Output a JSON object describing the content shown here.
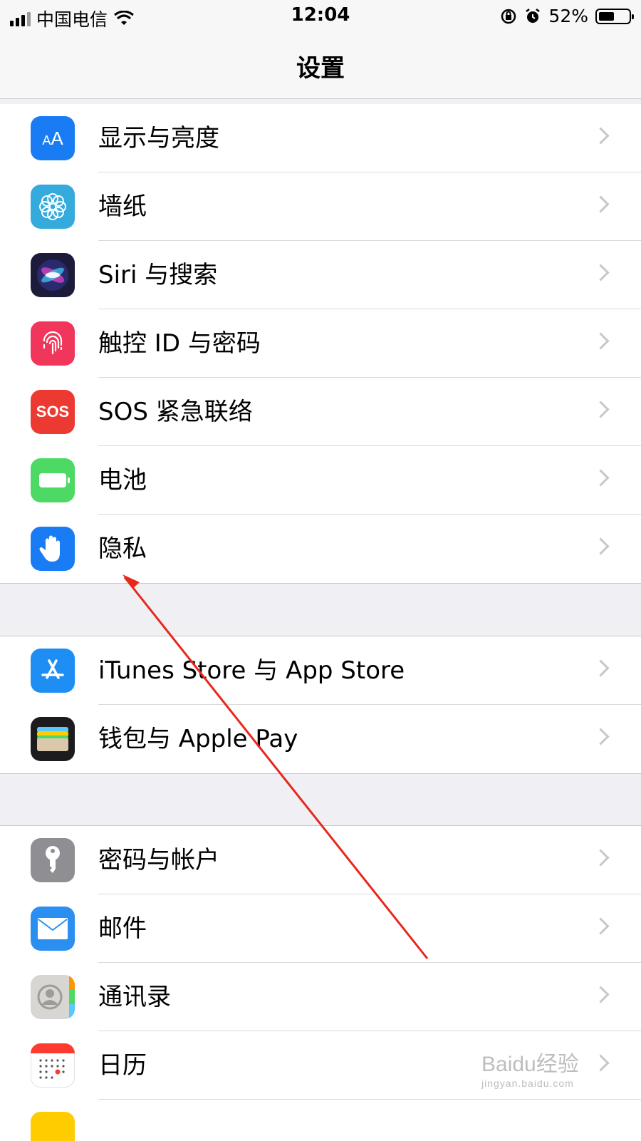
{
  "status_bar": {
    "carrier": "中国电信",
    "time": "12:04",
    "battery_text": "52%",
    "battery_level": 0.52
  },
  "nav": {
    "title": "设置"
  },
  "sections": [
    {
      "items": [
        {
          "label": "显示与亮度",
          "icon": "display-brightness-icon",
          "color": "#1a7cf5"
        },
        {
          "label": "墙纸",
          "icon": "wallpaper-flower-icon",
          "color": "#35aadc"
        },
        {
          "label": "Siri 与搜索",
          "icon": "siri-icon",
          "color": "#2b2450"
        },
        {
          "label": "触控 ID 与密码",
          "icon": "fingerprint-icon",
          "color": "#f0365a"
        },
        {
          "label": "SOS 紧急联络",
          "icon": "sos-icon",
          "color": "#ec3a33"
        },
        {
          "label": "电池",
          "icon": "battery-icon",
          "color": "#4cd964"
        },
        {
          "label": "隐私",
          "icon": "privacy-hand-icon",
          "color": "#1a7cf5"
        }
      ]
    },
    {
      "items": [
        {
          "label": "iTunes Store 与 App Store",
          "icon": "app-store-icon",
          "color": "#1e8ef5"
        },
        {
          "label": "钱包与 Apple Pay",
          "icon": "wallet-icon",
          "color": "#1c1c1e"
        }
      ]
    },
    {
      "items": [
        {
          "label": "密码与帐户",
          "icon": "key-icon",
          "color": "#8e8e93"
        },
        {
          "label": "邮件",
          "icon": "mail-icon",
          "color": "#2b8ff2"
        },
        {
          "label": "通讯录",
          "icon": "contacts-icon",
          "color": "#cfcfcf"
        },
        {
          "label": "日历",
          "icon": "calendar-icon",
          "color": "#ffffff"
        }
      ]
    }
  ],
  "icon_glyphs": {
    "display": "AA",
    "sos": "SOS"
  },
  "annotation_color": "#e8281c",
  "watermark": {
    "main": "Baidu经验",
    "sub": "jingyan.baidu.com"
  }
}
